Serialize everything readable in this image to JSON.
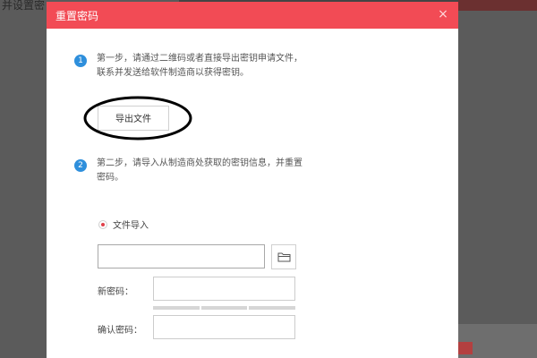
{
  "background": {
    "text": "并设置密"
  },
  "dialog": {
    "title": "重置密码",
    "close_symbol": "×",
    "step1": {
      "number": "1",
      "line1": "第一步，请通过二维码或者直接导出密钥申请文件，",
      "line2": "联系并发送给软件制造商以获得密钥。"
    },
    "export_button_label": "导出文件",
    "step2": {
      "number": "2",
      "line1": "第二步，请导入从制造商处获取的密钥信息，并重置",
      "line2": "密码。"
    },
    "radio_label": "文件导入",
    "file_input_value": "",
    "new_password_label": "新密码：",
    "confirm_password_label": "确认密码："
  },
  "colors": {
    "header": "#f24b55",
    "step_badge": "#2e8fdc",
    "radio_selected": "#e0404a"
  }
}
